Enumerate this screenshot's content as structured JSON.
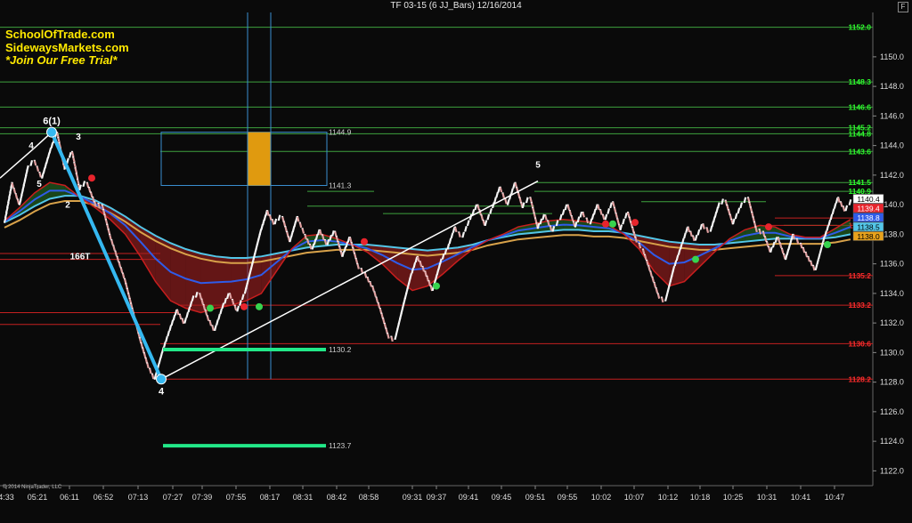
{
  "window": {
    "title": "TF 03-15 (6 JJ_Bars)  12/16/2014",
    "f_button": "F"
  },
  "watermark": [
    "SchoolOfTrade.com",
    "SidewaysMarkets.com",
    "*Join Our Free Trial*"
  ],
  "copyright": "© 2014 NinjaTrader, LLC",
  "colors": {
    "background": "#0a0a0a",
    "green_level": "#3ea23e",
    "red_level": "#c42020",
    "white_trend": "#ffffff",
    "cyan_wave": "#35b8f0",
    "bright_green_bar": "#22e888",
    "orange_box": "#e09a0f",
    "bar_up": "#f2f2f2",
    "bar_down": "#e0a0a0"
  },
  "chart_data": {
    "type": "line",
    "title": "TF 03-15 (6 JJ_Bars)  12/16/2014",
    "ylim": [
      1121.0,
      1153.0
    ],
    "grid": false,
    "y_ticks": [
      "1122.0",
      "1124.0",
      "1126.0",
      "1128.0",
      "1130.0",
      "1132.0",
      "1134.0",
      "1136.0",
      "1138.0",
      "1140.0",
      "1142.0",
      "1144.0",
      "1146.0",
      "1148.0",
      "1150.0"
    ],
    "x_ticks": [
      "4:33",
      "05:21",
      "06:11",
      "06:52",
      "07:13",
      "07:27",
      "07:39",
      "07:55",
      "08:17",
      "08:31",
      "08:42",
      "08:58",
      "09:31",
      "09:37",
      "09:41",
      "09:45",
      "09:51",
      "09:55",
      "10:02",
      "10:07",
      "10:12",
      "10:18",
      "10:25",
      "10:31",
      "10:41",
      "10:47"
    ],
    "price_series": {
      "name": "",
      "values": [
        1138.8,
        1141.5,
        1140.0,
        1142.3,
        1143.0,
        1141.8,
        1143.5,
        1144.9,
        1142.4,
        1143.6,
        1141.0,
        1141.5,
        1140.2,
        1140.0,
        1138.0,
        1136.5,
        1135.0,
        1133.0,
        1131.0,
        1129.3,
        1128.2,
        1130.0,
        1131.5,
        1132.9,
        1132.0,
        1133.5,
        1134.0,
        1132.5,
        1131.5,
        1133.0,
        1134.0,
        1132.8,
        1134.0,
        1136.0,
        1138.0,
        1139.6,
        1138.7,
        1139.2,
        1137.5,
        1139.2,
        1138.0,
        1137.0,
        1138.3,
        1137.3,
        1138.2,
        1136.5,
        1137.8,
        1136.0,
        1135.4,
        1134.5,
        1133.0,
        1131.3,
        1130.9,
        1133.0,
        1135.0,
        1136.5,
        1135.5,
        1134.2,
        1136.0,
        1137.0,
        1138.5,
        1137.8,
        1139.0,
        1140.0,
        1138.6,
        1139.8,
        1141.2,
        1140.0,
        1141.5,
        1139.8,
        1140.5,
        1138.4,
        1139.3,
        1138.2,
        1139.0,
        1140.0,
        1138.5,
        1139.5,
        1138.7,
        1140.0,
        1139.0,
        1140.2,
        1138.3,
        1139.5,
        1137.8,
        1137.0,
        1135.5,
        1134.0,
        1133.5,
        1135.5,
        1137.0,
        1138.5,
        1137.6,
        1138.7,
        1138.2,
        1139.8,
        1140.3,
        1138.7,
        1139.8,
        1140.5,
        1138.5,
        1138.2,
        1136.8,
        1137.8,
        1136.3,
        1138.0,
        1137.4,
        1136.5,
        1135.6,
        1137.5,
        1139.0,
        1140.5,
        1139.6,
        1140.4
      ],
      "last": 1140.4
    },
    "ribbon": {
      "fast_line": [
        1138.9,
        1139.8,
        1140.8,
        1141.5,
        1141.3,
        1140.5,
        1139.8,
        1139.0,
        1138.0,
        1136.5,
        1134.8,
        1133.5,
        1133.0,
        1132.7,
        1133.0,
        1133.2,
        1133.5,
        1134.0,
        1135.5,
        1137.0,
        1137.9,
        1138.0,
        1137.7,
        1137.3,
        1136.8,
        1136.0,
        1135.0,
        1134.2,
        1134.5,
        1135.3,
        1136.2,
        1137.0,
        1137.6,
        1138.0,
        1138.5,
        1138.7,
        1138.9,
        1139.0,
        1138.9,
        1138.8,
        1138.6,
        1138.0,
        1137.0,
        1135.5,
        1134.5,
        1134.8,
        1135.8,
        1136.8,
        1137.7,
        1138.3,
        1138.6,
        1138.5,
        1138.0,
        1137.8,
        1137.8,
        1138.4,
        1139.0
      ],
      "slow_line": [
        1138.8,
        1139.3,
        1139.9,
        1140.4,
        1140.6,
        1140.6,
        1140.3,
        1139.8,
        1139.2,
        1138.5,
        1137.9,
        1137.4,
        1137.0,
        1136.7,
        1136.5,
        1136.4,
        1136.4,
        1136.5,
        1136.7,
        1136.9,
        1137.1,
        1137.2,
        1137.3,
        1137.3,
        1137.3,
        1137.2,
        1137.1,
        1137.0,
        1136.9,
        1137.0,
        1137.1,
        1137.3,
        1137.6,
        1137.8,
        1138.0,
        1138.1,
        1138.2,
        1138.3,
        1138.3,
        1138.2,
        1138.2,
        1138.1,
        1137.9,
        1137.7,
        1137.5,
        1137.4,
        1137.3,
        1137.3,
        1137.4,
        1137.5,
        1137.6,
        1137.7,
        1137.7,
        1137.7,
        1137.7,
        1137.8,
        1138.0
      ]
    },
    "green_levels": [
      1152.0,
      1148.3,
      1146.6,
      1145.2,
      1144.8,
      1143.6,
      1141.5,
      1140.9
    ],
    "red_levels": [
      1139.1,
      1138.6,
      1135.2,
      1133.2,
      1130.6,
      1128.2
    ],
    "level_labels": {
      "green": [
        "1152.0",
        "1148.3",
        "1146.6",
        "1145.2",
        "1144.8",
        "1143.6",
        "1141.5",
        "1140.9"
      ],
      "red": [
        "1138.6",
        "1135.2",
        "1133.2",
        "1130.6",
        "1128.2"
      ]
    },
    "price_tags": [
      {
        "label": "1140.4",
        "color": "#ffffff",
        "text_color": "#000000"
      },
      {
        "label": "1139.4",
        "color": "#e8242c",
        "text_color": "#ffffff"
      },
      {
        "label": "1138.8",
        "color": "#2f5be8",
        "text_color": "#ffffff"
      },
      {
        "label": "1138.5",
        "color": "#53c6e8",
        "text_color": "#000000"
      },
      {
        "label": "1138.0",
        "color": "#e8a21c",
        "text_color": "#000000"
      }
    ],
    "projection_box": {
      "label_top": "1144.9",
      "label_bottom": "1141.3",
      "top": 1144.9,
      "bottom": 1141.3
    },
    "target_lines": [
      {
        "label": "1130.2",
        "value": 1130.2
      },
      {
        "label": "1123.7",
        "value": 1123.7
      }
    ],
    "wave_points": [
      {
        "label": "6(1)",
        "value": 1144.9
      },
      {
        "label": "4",
        "value": 1128.2
      }
    ],
    "trend_lines": [
      {
        "name": "white-trend-1",
        "from": 1141.8,
        "to": 1143.8
      },
      {
        "name": "white-trend-2",
        "from": 1128.2,
        "to": 1141.6
      }
    ],
    "annotations": [
      {
        "text": "4",
        "value": 1143.8
      },
      {
        "text": "5",
        "value": 1141.2
      },
      {
        "text": "3",
        "value": 1144.4
      },
      {
        "text": "2",
        "value": 1139.8
      },
      {
        "text": "166T",
        "value": 1136.3
      },
      {
        "text": "5",
        "value": 1142.5
      }
    ],
    "dots": [
      {
        "color": "red",
        "value": 1141.8
      },
      {
        "color": "green",
        "value": 1133.0
      },
      {
        "color": "red",
        "value": 1133.1
      },
      {
        "color": "green",
        "value": 1133.1
      },
      {
        "color": "red",
        "value": 1137.5
      },
      {
        "color": "green",
        "value": 1134.5
      },
      {
        "color": "red",
        "value": 1138.7
      },
      {
        "color": "green",
        "value": 1138.7
      },
      {
        "color": "red",
        "value": 1138.8
      },
      {
        "color": "green",
        "value": 1136.3
      },
      {
        "color": "red",
        "value": 1138.5
      },
      {
        "color": "green",
        "value": 1137.3
      }
    ]
  }
}
